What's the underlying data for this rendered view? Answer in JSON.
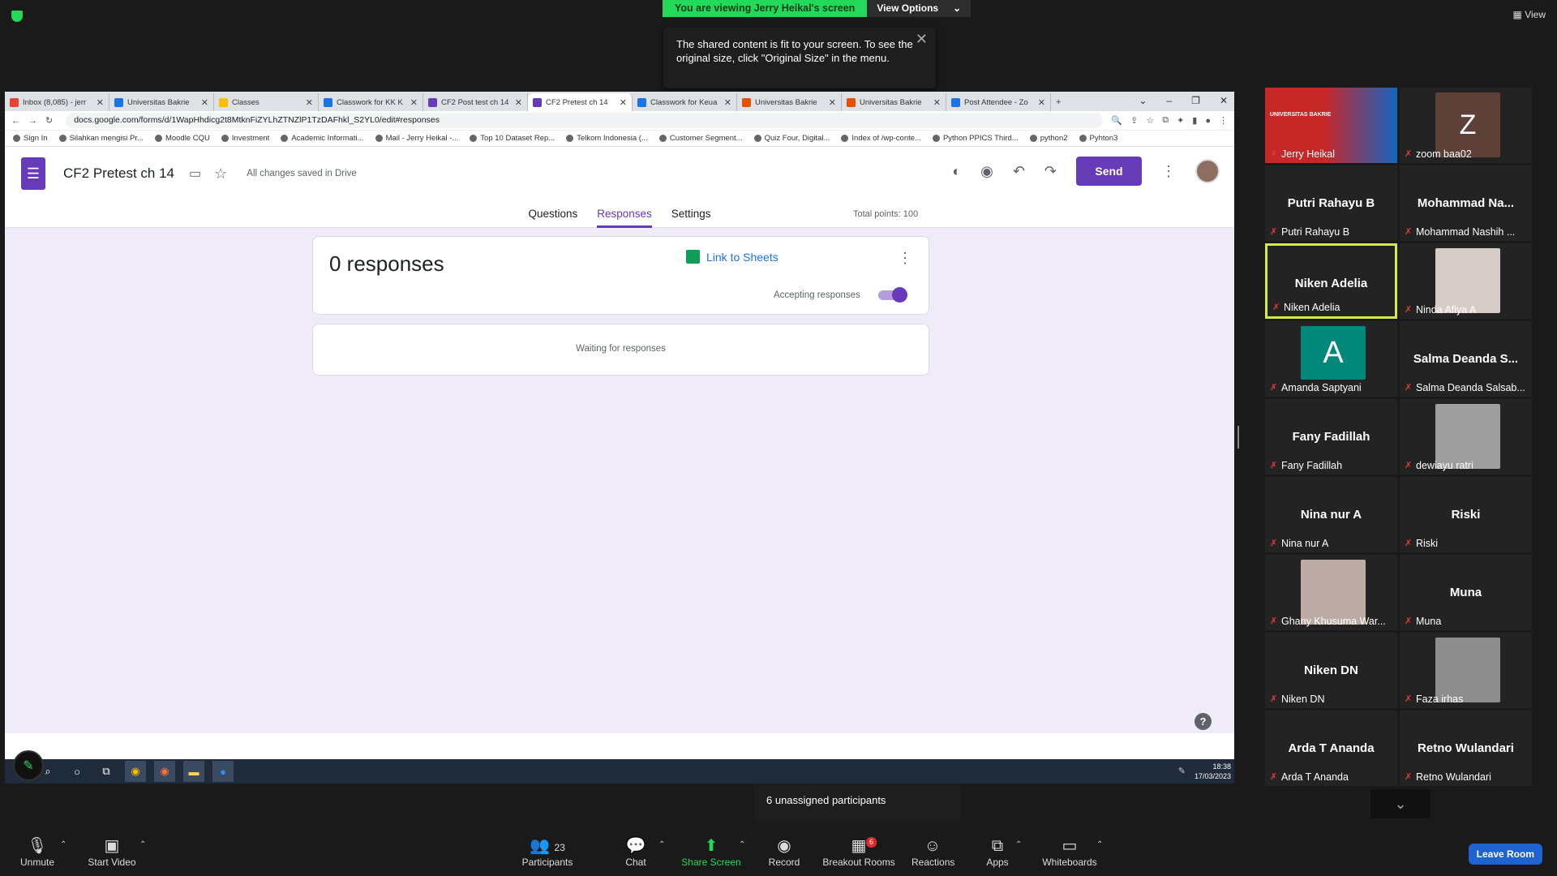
{
  "zoom": {
    "viewing_banner": "You are viewing Jerry Heikal's screen",
    "view_options": "View Options",
    "view_button": "View",
    "tooltip": "The shared content is fit to your screen. To see the original size, click \"Original Size\" in the menu.",
    "unassigned": "6 unassigned participants",
    "leave_room": "Leave Room",
    "toolbar": {
      "unmute": "Unmute",
      "start_video": "Start Video",
      "participants": "Participants",
      "participants_count": "23",
      "chat": "Chat",
      "share_screen": "Share Screen",
      "record": "Record",
      "breakout_rooms": "Breakout Rooms",
      "breakout_badge": "6",
      "reactions": "Reactions",
      "apps": "Apps",
      "whiteboards": "Whiteboards"
    },
    "participants": [
      {
        "display": "",
        "label": "Jerry Heikal",
        "photo": "#c62828"
      },
      {
        "display": "",
        "label": "zoom baa02",
        "photo": "#5d4037"
      },
      {
        "display": "Putri Rahayu B",
        "label": "Putri Rahayu B"
      },
      {
        "display": "Mohammad  Na...",
        "label": "Mohammad Nashih ..."
      },
      {
        "display": "Niken Adelia",
        "label": "Niken Adelia"
      },
      {
        "display": "",
        "label": "Ninda Afiya A",
        "photo": "#d7ccc8"
      },
      {
        "display": "",
        "label": "Amanda Saptyani",
        "photo": "#00897b"
      },
      {
        "display": "Salma  Deanda  S...",
        "label": "Salma Deanda Salsab..."
      },
      {
        "display": "Fany Fadillah",
        "label": "Fany Fadillah"
      },
      {
        "display": "",
        "label": "dewiayu ratri",
        "photo": "#9e9e9e"
      },
      {
        "display": "Nina nur A",
        "label": "Nina nur A"
      },
      {
        "display": "Riski",
        "label": "Riski"
      },
      {
        "display": "",
        "label": "Ghany Khusuma War...",
        "photo": "#bcaaa4"
      },
      {
        "display": "Muna",
        "label": "Muna"
      },
      {
        "display": "Niken DN",
        "label": "Niken DN"
      },
      {
        "display": "",
        "label": "Faza irhas",
        "photo": "#8d8d8d"
      },
      {
        "display": "Arda T Ananda",
        "label": "Arda T Ananda"
      },
      {
        "display": "Retno Wulandari",
        "label": "Retno Wulandari"
      }
    ],
    "tile_letters": {
      "z": "Z",
      "a": "A"
    },
    "jerry_text": "UNIVERSITAS BAKRIE"
  },
  "browser": {
    "tabs": [
      {
        "label": "Inbox (8,085) - jerr",
        "color": "#ea4335"
      },
      {
        "label": "Universitas Bakrie",
        "color": "#1a73e8"
      },
      {
        "label": "Classes",
        "color": "#fbbc04"
      },
      {
        "label": "Classwork for KK K",
        "color": "#1a73e8"
      },
      {
        "label": "CF2 Post test ch 14",
        "color": "#673ab7"
      },
      {
        "label": "CF2 Pretest ch 14",
        "color": "#673ab7"
      },
      {
        "label": "Classwork for Keua",
        "color": "#1a73e8"
      },
      {
        "label": "Universitas Bakrie",
        "color": "#e65100"
      },
      {
        "label": "Universitas Bakrie",
        "color": "#e65100"
      },
      {
        "label": "Post Attendee - Zo",
        "color": "#1a73e8"
      }
    ],
    "url": "docs.google.com/forms/d/1WapHhdicg2t8MtknFiZYLhZTNZlP1TzDAFhkl_S2YL0/edit#responses",
    "bookmarks": [
      "Sign In",
      "Silahkan mengisi Pr...",
      "Moodle CQU",
      "Investment",
      "Academic Informati...",
      "Mail - Jerry Heikal -...",
      "Top 10 Dataset Rep...",
      "Telkom Indonesia (...",
      "Customer Segment...",
      "Quiz Four, Digital...",
      "Index of /wp-conte...",
      "Python PPICS Third...",
      "python2",
      "Pyhton3"
    ]
  },
  "forms": {
    "title": "CF2 Pretest ch 14",
    "saved": "All changes saved in Drive",
    "send": "Send",
    "tabs": [
      "Questions",
      "Responses",
      "Settings"
    ],
    "total_points": "Total points: 100",
    "responses_count": "0 responses",
    "link_sheets": "Link to Sheets",
    "accepting": "Accepting responses",
    "accepting_on": true,
    "waiting": "Waiting for responses"
  },
  "taskbar": {
    "time": "18:38",
    "date": "17/03/2023"
  }
}
